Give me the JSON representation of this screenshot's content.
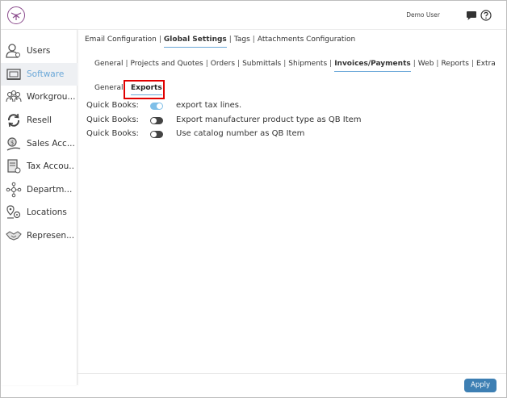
{
  "header": {
    "user_name": "Demo User"
  },
  "sidebar": {
    "items": [
      {
        "label": "Users",
        "icon": "users-icon"
      },
      {
        "label": "Software",
        "icon": "software-icon",
        "active": true
      },
      {
        "label": "Workgrou...",
        "icon": "workgroups-icon"
      },
      {
        "label": "Resell",
        "icon": "resell-icon"
      },
      {
        "label": "Sales Acc...",
        "icon": "sales-accounts-icon"
      },
      {
        "label": "Tax Accou...",
        "icon": "tax-accounts-icon"
      },
      {
        "label": "Departm...",
        "icon": "departments-icon"
      },
      {
        "label": "Locations",
        "icon": "locations-icon"
      },
      {
        "label": "Represen...",
        "icon": "representatives-icon"
      }
    ]
  },
  "tabs_level1": [
    {
      "label": "Email Configuration"
    },
    {
      "label": "Global Settings",
      "active": true
    },
    {
      "label": "Tags"
    },
    {
      "label": "Attachments Configuration"
    }
  ],
  "tabs_level2": [
    {
      "label": "General"
    },
    {
      "label": "Projects and Quotes"
    },
    {
      "label": "Orders"
    },
    {
      "label": "Submittals"
    },
    {
      "label": "Shipments"
    },
    {
      "label": "Invoices/Payments",
      "active": true
    },
    {
      "label": "Web"
    },
    {
      "label": "Reports"
    },
    {
      "label": "Extra"
    }
  ],
  "tabs_level3": {
    "general": "General",
    "exports": "Exports"
  },
  "settings": [
    {
      "source": "Quick Books:",
      "enabled": true,
      "label": "export tax lines."
    },
    {
      "source": "Quick Books:",
      "enabled": false,
      "label": "Export manufacturer product type as QB Item"
    },
    {
      "source": "Quick Books:",
      "enabled": false,
      "label": "Use catalog number as QB Item"
    }
  ],
  "footer": {
    "apply_label": "Apply"
  },
  "colors": {
    "accent": "#6aa7d8",
    "highlight": "#e00000",
    "apply": "#3d7fb3"
  }
}
